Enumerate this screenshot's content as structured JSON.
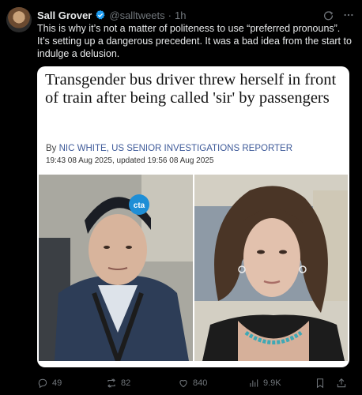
{
  "author": {
    "name": "Sall Grover",
    "handle": "@salltweets",
    "separator": "·",
    "time": "1h"
  },
  "tweet_text": "This is why it’s not a matter of politeness to use “preferred pronouns”. It’s setting up a dangerous precedent. It was a bad idea from the start to indulge a delusion.",
  "card": {
    "headline": "Transgender bus driver threw herself in front of train after being called 'sir' by passengers",
    "byline_prefix": "By ",
    "byline_author": "NIC WHITE, US SENIOR INVESTIGATIONS REPORTER",
    "dateline": "19:43 08 Aug 2025, updated 19:56 08 Aug 2025",
    "hat_logo_text": "cta"
  },
  "actions": {
    "replies": "49",
    "reposts": "82",
    "likes": "840",
    "views": "9.9K"
  },
  "colors": {
    "verified": "#1d9bf0",
    "byline": "#3e5a99"
  },
  "icons": [
    "verified-badge-icon",
    "grok-icon",
    "more-icon",
    "reply-icon",
    "repost-icon",
    "like-icon",
    "views-icon",
    "bookmark-icon",
    "share-icon"
  ]
}
